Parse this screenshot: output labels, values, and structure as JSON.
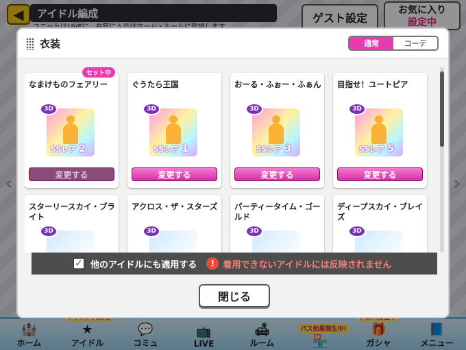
{
  "background": {
    "title": "アイドル編成",
    "subtitle": "ユニットはLIVEに、お気に入りはホーム・ルームに登場します",
    "guest_button": "ゲスト設定",
    "favorite_button": "お気に入り",
    "favorite_status": "設定中",
    "nav": [
      {
        "icon": "castle-icon",
        "glyph": "🏰",
        "label": "ホーム",
        "badge": ""
      },
      {
        "icon": "idol-icon",
        "glyph": "★",
        "label": "アイドル",
        "badge": "レッスン大成功"
      },
      {
        "icon": "chat-icon",
        "glyph": "💬",
        "label": "コミュ",
        "badge": ""
      },
      {
        "icon": "tv-icon",
        "glyph": "📺",
        "label": "LIVE",
        "badge": ""
      },
      {
        "icon": "room-icon",
        "glyph": "🛋",
        "label": "ルーム",
        "badge": ""
      },
      {
        "icon": "shop-icon",
        "glyph": "🏪",
        "label": "",
        "badge": "パス効果発生中!"
      },
      {
        "icon": "gacha-icon",
        "glyph": "🎁",
        "label": "ガシャ",
        "badge": "フェス開催中"
      },
      {
        "icon": "menu-icon",
        "glyph": "📘",
        "label": "メニュー",
        "badge": ""
      }
    ]
  },
  "modal": {
    "title": "衣装",
    "tabs": [
      "通常",
      "コーデ"
    ],
    "active_tab": "通常",
    "set_badge": "セット中",
    "badge_3d": "3D",
    "rarity_label": "SSレア",
    "change_label": "変更する",
    "costumes": [
      {
        "name": "なまけものフェアリー",
        "rarity_num": "2",
        "equipped": true
      },
      {
        "name": "ぐうたら王国",
        "rarity_num": "1",
        "equipped": false
      },
      {
        "name": "おーる・ふぉー・ふぁん",
        "rarity_num": "3",
        "equipped": false
      },
      {
        "name": "目指せ！ユートピア",
        "rarity_num": "5",
        "equipped": false
      },
      {
        "name": "スターリースカイ・ブライト",
        "rarity_num": "",
        "equipped": false
      },
      {
        "name": "アクロス・ザ・スターズ",
        "rarity_num": "",
        "equipped": false
      },
      {
        "name": "パーティータイム・ゴールド",
        "rarity_num": "",
        "equipped": false
      },
      {
        "name": "ディープスカイ・ブレイズ",
        "rarity_num": "",
        "equipped": false
      }
    ],
    "apply_all_label": "他のアイドルにも適用する",
    "apply_all_checked": true,
    "warning": "着用できないアイドルには反映されません",
    "close_label": "閉じる"
  }
}
